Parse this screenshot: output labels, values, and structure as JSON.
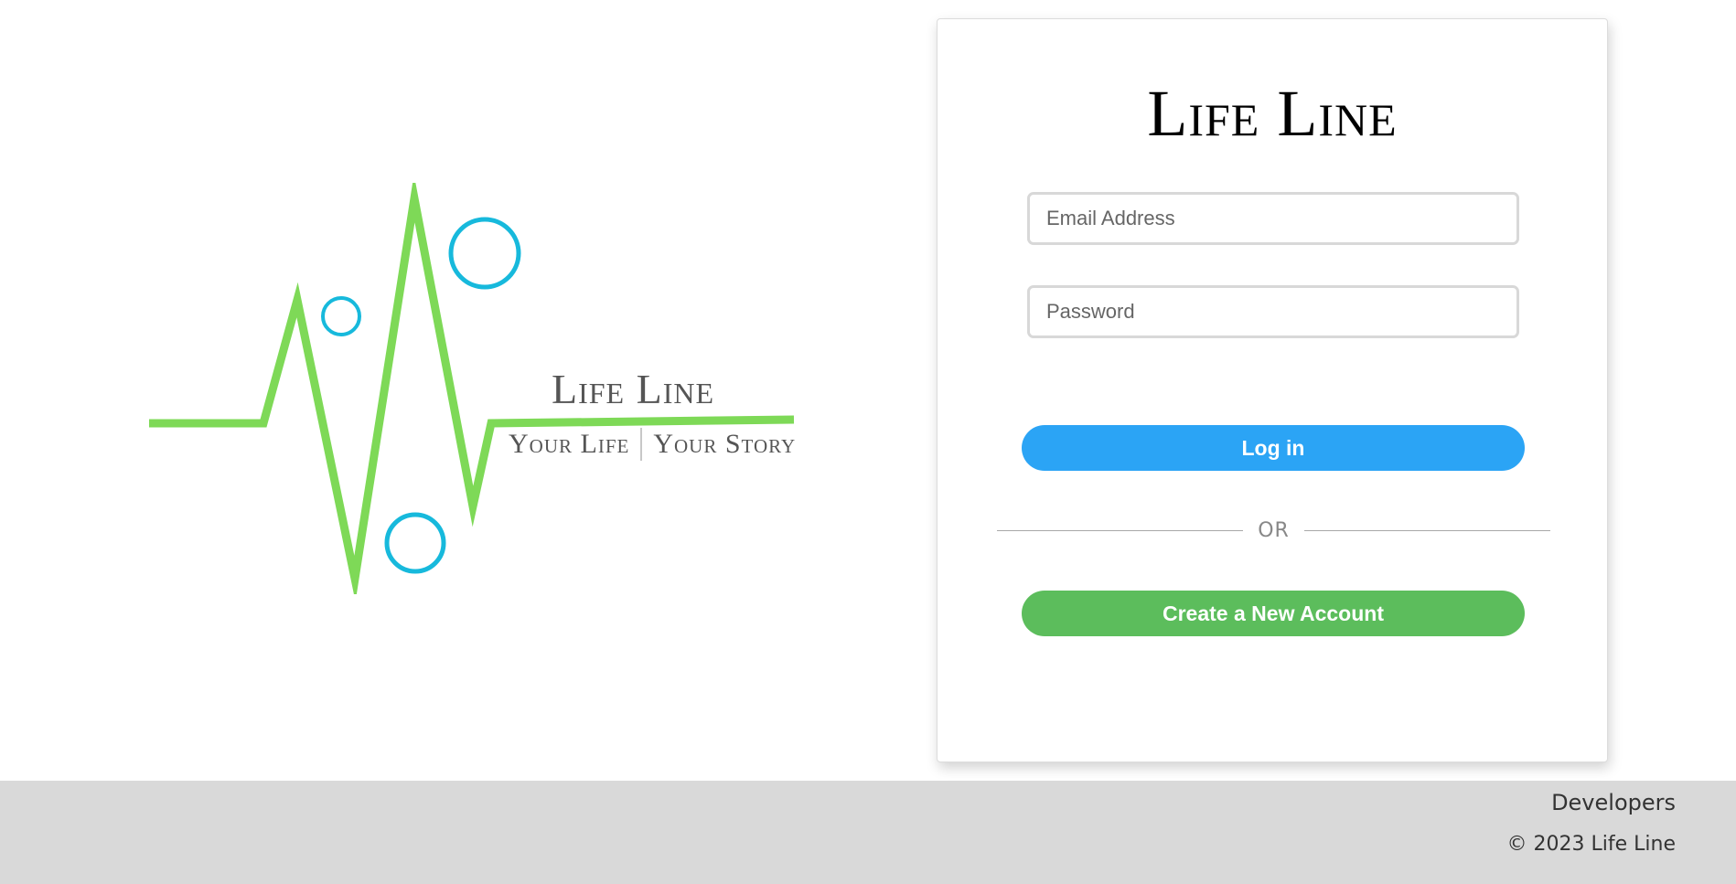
{
  "logo": {
    "title": "Life Line",
    "tagline_left": "Your Life",
    "tagline_right": "Your Story",
    "icon": "heartbeat-line-with-circles",
    "colors": {
      "line": "#7ed957",
      "circles": "#17b9dc",
      "text": "#555555"
    }
  },
  "login_card": {
    "title": "Life Line",
    "email": {
      "placeholder": "Email Address",
      "value": ""
    },
    "password": {
      "placeholder": "Password",
      "value": ""
    },
    "login_label": "Log in",
    "divider_text": "OR",
    "create_account_label": "Create a New Account",
    "colors": {
      "login_button": "#2ba4f5",
      "create_button": "#5cbd5c"
    }
  },
  "footer": {
    "developers_link": "Developers",
    "copyright": "© 2023 Life Line",
    "background": "#d9d9d9"
  }
}
